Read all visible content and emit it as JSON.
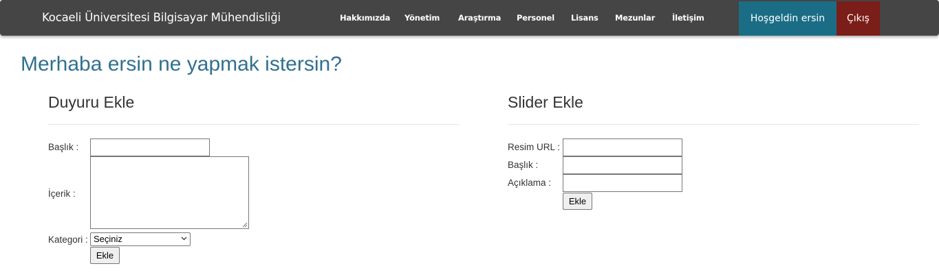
{
  "navbar": {
    "brand": "Kocaeli Üniversitesi Bilgisayar Mühendisliği",
    "links": [
      "Hakkımızda",
      "Yönetim",
      "Araştırma",
      "Personel",
      "Lisans",
      "Mezunlar",
      "İletişim"
    ],
    "welcome": "Hoşgeldin ersin",
    "logout": "Çıkış"
  },
  "greeting": "Merhaba ersin ne yapmak istersin?",
  "announcement_form": {
    "title": "Duyuru Ekle",
    "title_label": "Başlık :",
    "title_value": "",
    "content_label": "İçerik :",
    "content_value": "",
    "category_label": "Kategori :",
    "category_selected": "Seçiniz",
    "submit_label": "Ekle"
  },
  "slider_form": {
    "title": "Slider Ekle",
    "image_url_label": "Resim URL :",
    "image_url_value": "",
    "title_label": "Başlık :",
    "title_value": "",
    "description_label": "Açıklama :",
    "description_value": "",
    "submit_label": "Ekle"
  },
  "colors": {
    "navbar_bg": "#454545",
    "welcome_bg": "#1b6d86",
    "logout_bg": "#7b1d18",
    "greeting_text": "#31708f"
  }
}
